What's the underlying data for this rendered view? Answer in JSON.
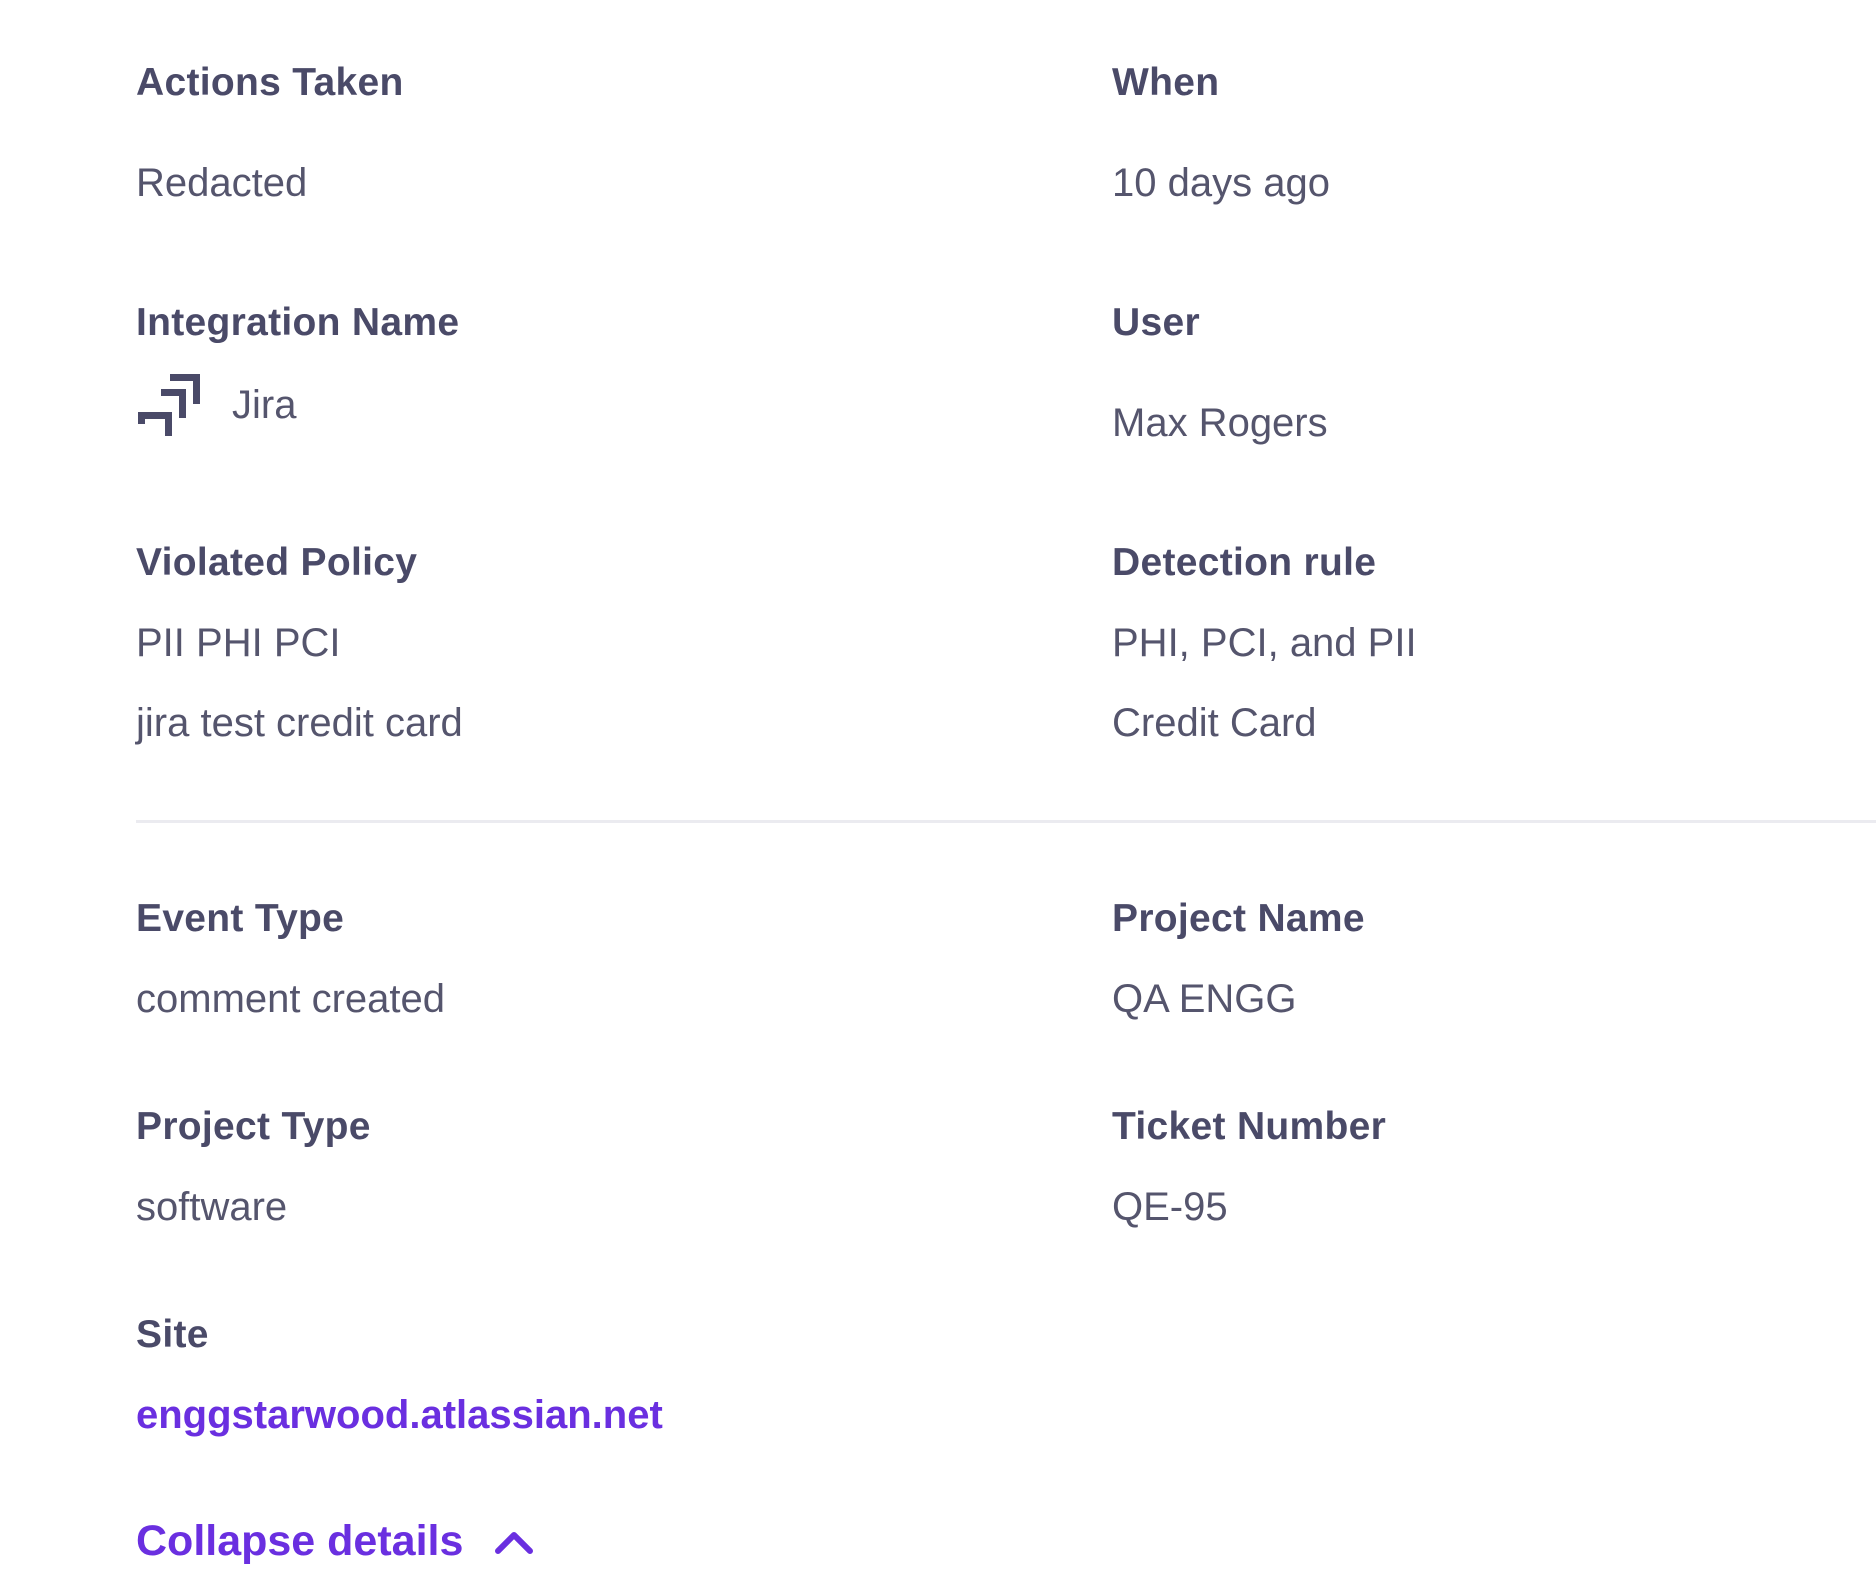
{
  "fields": {
    "actions_taken": {
      "label": "Actions Taken",
      "value": "Redacted"
    },
    "when": {
      "label": "When",
      "value": "10 days ago"
    },
    "integration_name": {
      "label": "Integration Name",
      "value": "Jira",
      "icon": "jira-icon"
    },
    "user": {
      "label": "User",
      "value": "Max Rogers"
    },
    "violated_policy": {
      "label": "Violated Policy",
      "values": [
        "PII PHI PCI",
        "jira test credit card"
      ]
    },
    "detection_rule": {
      "label": "Detection rule",
      "values": [
        "PHI, PCI, and PII",
        "Credit Card"
      ]
    },
    "event_type": {
      "label": "Event Type",
      "value": "comment created"
    },
    "project_name": {
      "label": "Project Name",
      "value": "QA ENGG"
    },
    "project_type": {
      "label": "Project Type",
      "value": "software"
    },
    "ticket_number": {
      "label": "Ticket Number",
      "value": "QE-95"
    },
    "site": {
      "label": "Site",
      "value": "enggstarwood.atlassian.net"
    }
  },
  "collapse": {
    "label": "Collapse details",
    "icon": "chevron-up-icon"
  },
  "colors": {
    "label": "#4a4a68",
    "value": "#55556d",
    "accent": "#6a2fe0",
    "divider": "#ebebf0"
  }
}
